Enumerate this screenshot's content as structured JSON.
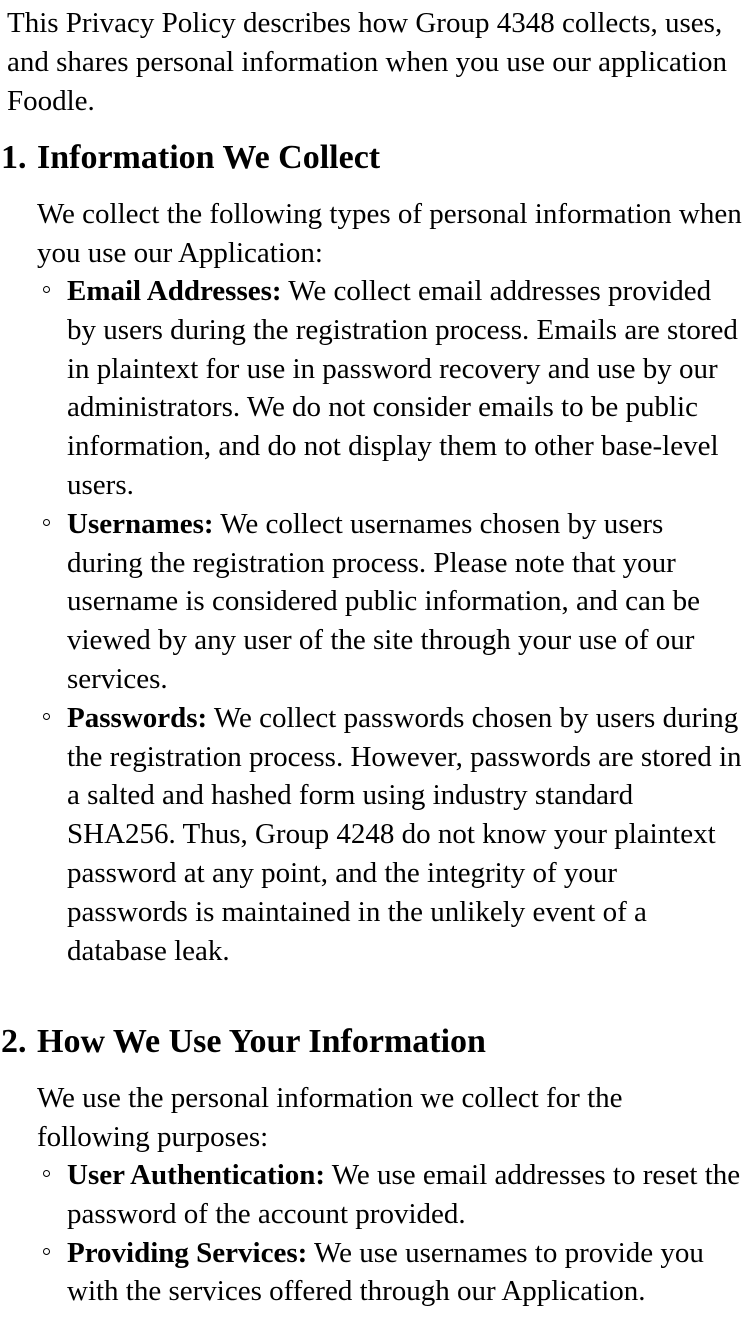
{
  "intro": "This Privacy Policy describes how Group 4348 collects, uses, and shares personal information when you use our application Foodle.",
  "sections": [
    {
      "number": "1.",
      "title": "Information We Collect",
      "lead": "We collect the following types of personal information when you use our Application:",
      "items": [
        {
          "term": "Email Addresses:",
          "text": " We collect email addresses provided by users during the registration process. Emails are stored in plaintext for use in password recovery and use by our administrators. We do not consider emails to be public information, and do not display them to other base-level users."
        },
        {
          "term": "Usernames:",
          "text": " We collect usernames chosen by users during the registration process. Please note that your username is considered public information, and can be viewed by any user of the site through your use of our services."
        },
        {
          "term": "Passwords:",
          "text": " We collect passwords chosen by users during the registration process. However, passwords are stored in a salted and hashed form using industry standard SHA256. Thus, Group 4248 do not know your plaintext password at any point, and the integrity of your passwords is maintained in the unlikely event of a database leak."
        }
      ]
    },
    {
      "number": "2.",
      "title": "How We Use Your Information",
      "lead": "We use the personal information we collect for the following purposes:",
      "items": [
        {
          "term": "User Authentication:",
          "text": " We use email addresses to reset the password of the account provided."
        },
        {
          "term": "Providing Services:",
          "text": " We use usernames to provide you with the services offered through our Application."
        }
      ]
    }
  ]
}
